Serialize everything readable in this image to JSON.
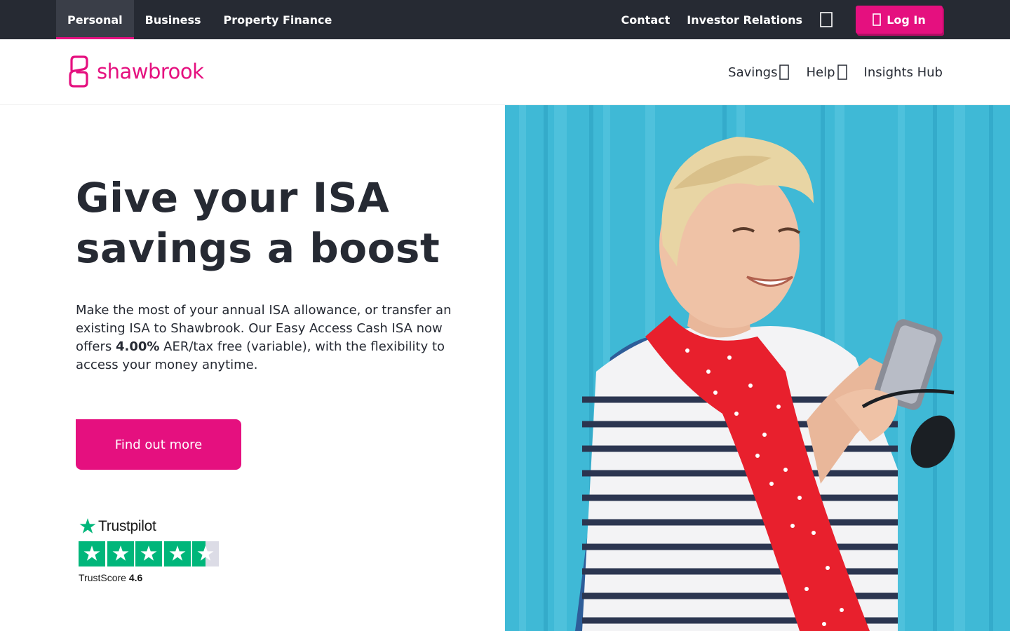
{
  "topbar": {
    "tabs": [
      {
        "label": "Personal",
        "active": true
      },
      {
        "label": "Business",
        "active": false
      },
      {
        "label": "Property Finance",
        "active": false
      }
    ],
    "links": {
      "contact": "Contact",
      "investor": "Investor Relations"
    },
    "search_icon": "search-icon",
    "login_label": "Log In",
    "login_icon": "lock-icon"
  },
  "brand": {
    "name": "shawbrook",
    "color": "#e5107f"
  },
  "mainnav": {
    "savings": "Savings",
    "help": "Help",
    "insights": "Insights Hub"
  },
  "hero": {
    "title": "Give your ISA savings a boost",
    "text_before": "Make the most of your annual ISA allowance, or transfer an existing ISA to Shawbrook. Our Easy Access Cash ISA now offers ",
    "rate": "4.00%",
    "text_after": " AER/tax free (variable), with the flexibility to access your money anytime.",
    "cta": "Find out more"
  },
  "trustpilot": {
    "brand": "Trustpilot",
    "score_label": "TrustScore",
    "score": "4.6",
    "stars_filled": 4.5,
    "stars_total": 5
  },
  "colors": {
    "accent": "#e5107f",
    "dark": "#262a33",
    "trust_green": "#00b67a"
  }
}
